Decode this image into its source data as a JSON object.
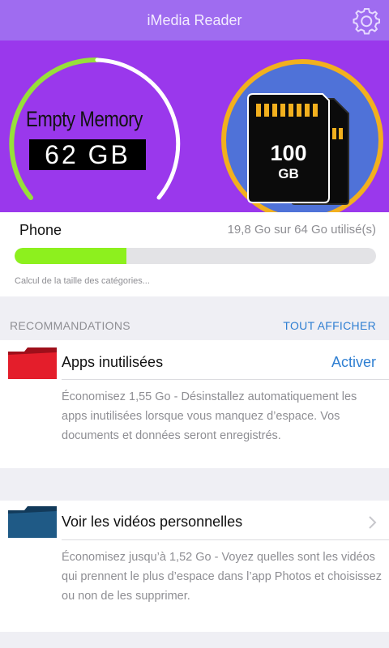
{
  "app": {
    "title": "iMedia Reader"
  },
  "hero": {
    "memory_label": "Empty Memory",
    "memory_value": "62 GB",
    "badge_text": "100",
    "badge_unit": "GB"
  },
  "storage": {
    "device": "Phone",
    "usage_text": "19,8 Go sur 64 Go utilisé(s)",
    "used_fraction": 0.31,
    "calculating_text": "Calcul de la taille des catégories..."
  },
  "recommendations": {
    "header": "RECOMMANDATIONS",
    "show_all": "TOUT AFFICHER",
    "items": [
      {
        "title": "Apps inutilisées",
        "action": "Activer",
        "description": "Économisez 1,55 Go - Désinstallez automatiquement les apps inutilisées lorsque vous manquez d’espace. Vos documents et données seront enregistrés.",
        "icon": "red-folder-icon",
        "color": "#e41e2b"
      },
      {
        "title": "Voir les vidéos personnelles",
        "description": "Économisez jusqu’à 1,52 Go - Voyez quelles sont les vidéos qui prennent le plus d’espace dans l’app Photos et choisissez ou non de les supprimer.",
        "icon": "blue-folder-icon",
        "color": "#1f5a86"
      }
    ]
  },
  "colors": {
    "topbar": "#9f6cf0",
    "hero": "#9a38ec",
    "progress": "#8df01e",
    "accent": "#2f7fd2",
    "badge_ring": "#f2b01e",
    "badge_bg": "#4f72d8"
  }
}
